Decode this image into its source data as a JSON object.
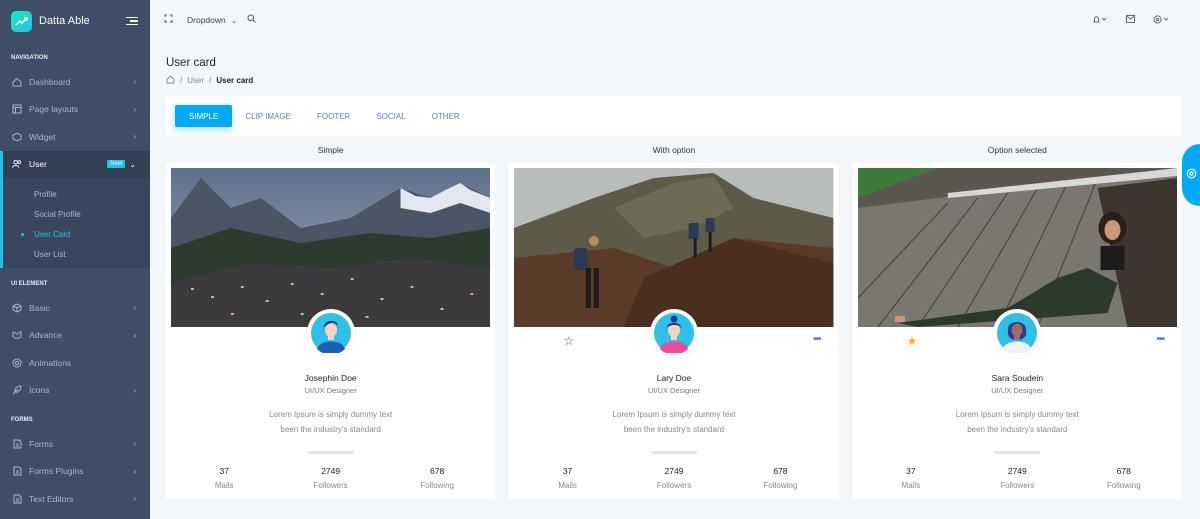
{
  "brand": {
    "name": "Datta Able"
  },
  "sidebar": {
    "sections": [
      {
        "caption": "Navigation"
      },
      {
        "caption": "UI Element"
      },
      {
        "caption": "Forms"
      }
    ],
    "items": [
      {
        "label": "Dashboard"
      },
      {
        "label": "Page layouts"
      },
      {
        "label": "Widget"
      },
      {
        "label": "User",
        "badge": "New"
      },
      {
        "label": "Basic"
      },
      {
        "label": "Advance"
      },
      {
        "label": "Animations"
      },
      {
        "label": "Icons"
      },
      {
        "label": "Forms"
      },
      {
        "label": "Forms Plugins"
      },
      {
        "label": "Text Editors"
      }
    ],
    "submenu": [
      {
        "label": "Profile"
      },
      {
        "label": "Social Profile"
      },
      {
        "label": "User Card"
      },
      {
        "label": "User List"
      }
    ]
  },
  "topbar": {
    "dropdown": "Dropdown"
  },
  "page": {
    "title": "User card",
    "breadcrumb": [
      "User",
      "User card"
    ]
  },
  "tabs": [
    "SIMPLE",
    "CLIP IMAGE",
    "FOOTER",
    "SOCIAL",
    "OTHER"
  ],
  "active_tab": "SIMPLE",
  "accent": "#04a9f5",
  "cards": [
    {
      "title": "Simple",
      "name": "Josephin Doe",
      "role": "UI/UX Designer",
      "desc1": "Lorem Ipsum is simply dummy text",
      "desc2": "been the industry's standard",
      "stats": [
        {
          "value": "37",
          "label": "Mails"
        },
        {
          "value": "2749",
          "label": "Followers"
        },
        {
          "value": "678",
          "label": "Following"
        }
      ]
    },
    {
      "title": "With option",
      "name": "Lary Doe",
      "role": "UI/UX Designer",
      "desc1": "Lorem Ipsum is simply dummy text",
      "desc2": "been the industry's standard",
      "starred": false,
      "stats": [
        {
          "value": "37",
          "label": "Mails"
        },
        {
          "value": "2749",
          "label": "Followers"
        },
        {
          "value": "678",
          "label": "Following"
        }
      ]
    },
    {
      "title": "Option selected",
      "name": "Sara Soudein",
      "role": "UI/UX Designer",
      "desc1": "Lorem Ipsum is simply dummy text",
      "desc2": "been the industry's standard",
      "starred": true,
      "stats": [
        {
          "value": "37",
          "label": "Mails"
        },
        {
          "value": "2749",
          "label": "Followers"
        },
        {
          "value": "678",
          "label": "Following"
        }
      ]
    }
  ]
}
